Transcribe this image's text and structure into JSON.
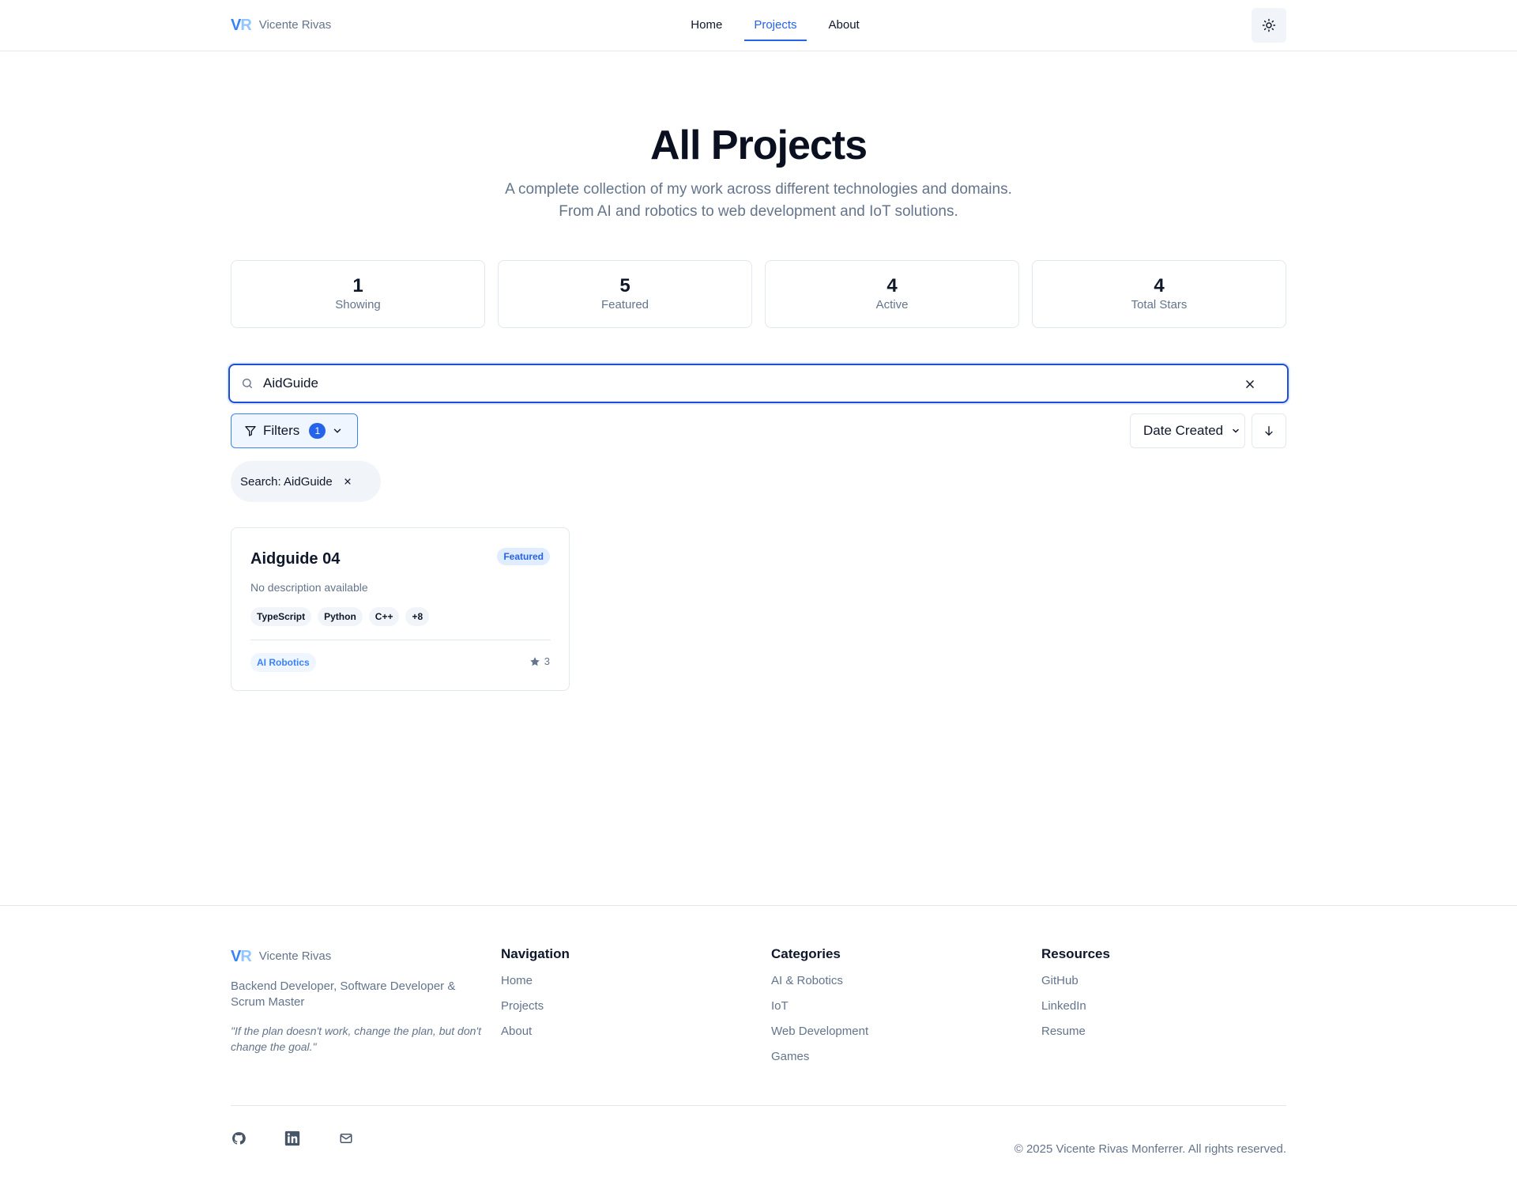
{
  "brand": {
    "logo_v": "V",
    "logo_r": "R",
    "name": "Vicente Rivas"
  },
  "nav": {
    "home": "Home",
    "projects": "Projects",
    "about": "About",
    "active": "Projects"
  },
  "hero": {
    "title": "All Projects",
    "subtitle_line1": "A complete collection of my work across different technologies and domains.",
    "subtitle_line2": "From AI and robotics to web development and IoT solutions."
  },
  "stats": [
    {
      "value": "1",
      "label": "Showing"
    },
    {
      "value": "5",
      "label": "Featured"
    },
    {
      "value": "4",
      "label": "Active"
    },
    {
      "value": "4",
      "label": "Total Stars"
    }
  ],
  "search": {
    "value": "AidGuide",
    "icon": "search-icon"
  },
  "filters": {
    "label": "Filters",
    "count": "1"
  },
  "sort": {
    "label": "Date Created",
    "direction": "descending"
  },
  "active_filters": [
    {
      "label": "Search: AidGuide"
    }
  ],
  "projects": [
    {
      "title": "Aidguide 04",
      "badge": "Featured",
      "description": "No description available",
      "tags": [
        "TypeScript",
        "Python",
        "C++",
        "+8"
      ],
      "category": "AI Robotics",
      "stars": "3"
    }
  ],
  "footer": {
    "role": "Backend Developer, Software Developer & Scrum Master",
    "quote": "\"If the plan doesn't work, change the plan, but don't change the goal.\"",
    "navigation": {
      "title": "Navigation",
      "links": [
        "Home",
        "Projects",
        "About"
      ]
    },
    "categories": {
      "title": "Categories",
      "links": [
        "AI & Robotics",
        "IoT",
        "Web Development",
        "Games"
      ]
    },
    "resources": {
      "title": "Resources",
      "links": [
        "GitHub",
        "LinkedIn",
        "Resume"
      ]
    },
    "social": [
      "github-icon",
      "linkedin-icon",
      "mail-icon"
    ],
    "copyright": "© 2025 Vicente Rivas Monferrer. All rights reserved."
  },
  "colors": {
    "accent": "#2563eb",
    "muted": "#64748b",
    "border": "#e2e8f0",
    "chip_bg": "#f1f5f9"
  }
}
